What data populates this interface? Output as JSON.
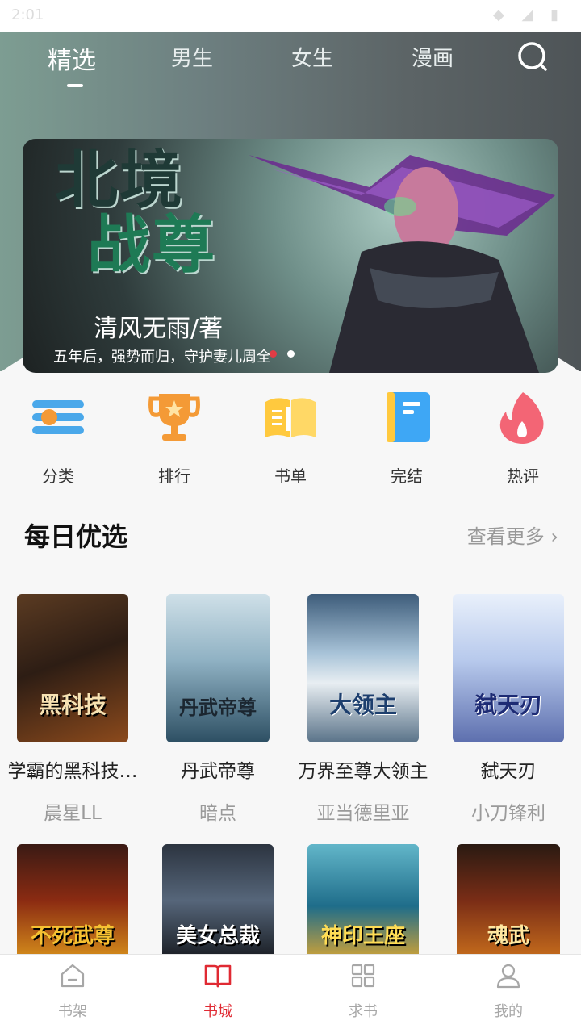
{
  "status_bar": {
    "time": "2:01",
    "indicators": "◆ ◢ ▮"
  },
  "top_tabs": [
    {
      "label": "精选",
      "active": true
    },
    {
      "label": "男生",
      "active": false
    },
    {
      "label": "女生",
      "active": false
    },
    {
      "label": "漫画",
      "active": false
    }
  ],
  "search": {
    "icon": "search-icon"
  },
  "banner": {
    "title_line1": "北境",
    "title_line2": "战尊",
    "author": "清风无雨/著",
    "tagline": "五年后，强势而归，守护妻儿周全",
    "active_dot": 1,
    "dot_count": 2
  },
  "quick_nav": [
    {
      "label": "分类",
      "icon": "category-icon",
      "color": "#4aa8ea"
    },
    {
      "label": "排行",
      "icon": "trophy-icon",
      "color": "#f49a36"
    },
    {
      "label": "书单",
      "icon": "booklist-icon",
      "color": "#ffc93e"
    },
    {
      "label": "完结",
      "icon": "finished-book-icon",
      "color": "#3ea7f5"
    },
    {
      "label": "热评",
      "icon": "flame-icon",
      "color": "#f36575"
    }
  ],
  "daily_picks": {
    "title": "每日优选",
    "see_more": "查看更多",
    "books": [
      {
        "title": "学霸的黑科技…",
        "author": "晨星LL",
        "cover_text": "黑科技"
      },
      {
        "title": "丹武帝尊",
        "author": "暗点",
        "cover_text": "丹武帝尊"
      },
      {
        "title": "万界至尊大领主",
        "author": "亚当德里亚",
        "cover_text": "大领主"
      },
      {
        "title": "弑天刃",
        "author": "小刀锋利",
        "cover_text": "弑天刃"
      }
    ],
    "books_row2": [
      {
        "cover_text": "不死武尊"
      },
      {
        "cover_text": "美女总裁"
      },
      {
        "cover_text": "神印王座"
      },
      {
        "cover_text": "魂武"
      }
    ]
  },
  "bottom_nav": [
    {
      "label": "书架",
      "active": false
    },
    {
      "label": "书城",
      "active": true
    },
    {
      "label": "求书",
      "active": false
    },
    {
      "label": "我的",
      "active": false
    }
  ]
}
